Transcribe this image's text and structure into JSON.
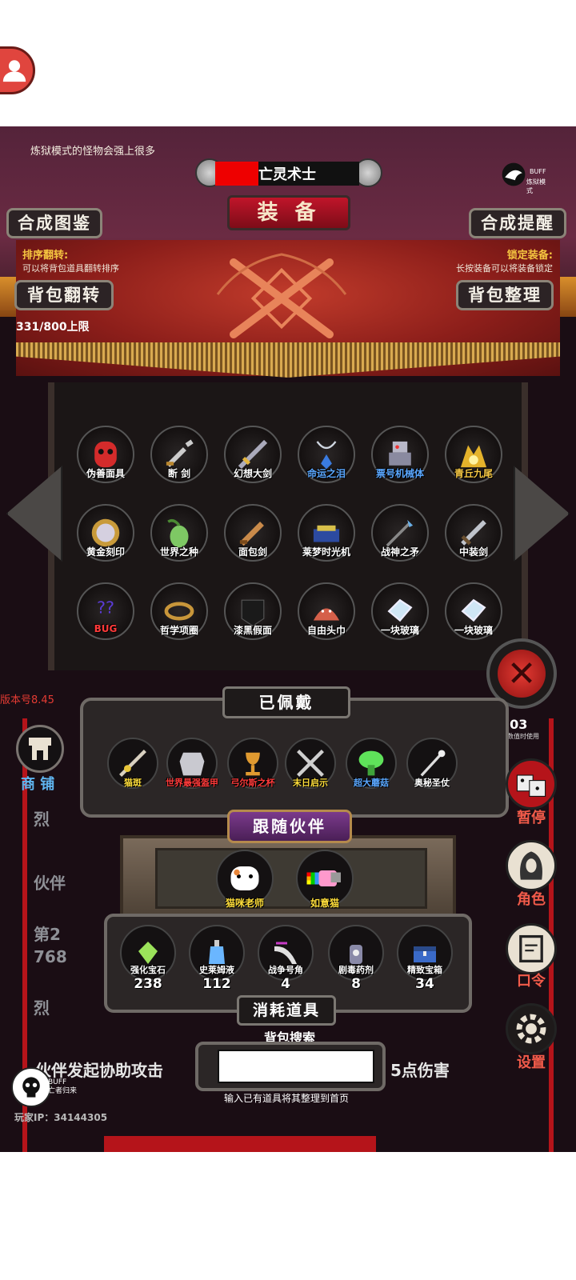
{
  "header": {
    "warning": "炼狱模式的怪物会强上很多",
    "buff_mode_label": "BUFF",
    "buff_mode_text": "炼狱模式",
    "class_name": "亡灵术士",
    "screen_title": "装 备"
  },
  "buttons": {
    "synth_atlas": "合成图鉴",
    "synth_reminder": "合成提醒",
    "bag_flip": "背包翻转",
    "bag_sort": "背包整理"
  },
  "hints": {
    "sort_flip_title": "排序翻转:",
    "sort_flip_desc": "可以将背包道具翻转排序",
    "lock_equip_title": "锁定装备:",
    "lock_equip_desc": "长按装备可以将装备锁定"
  },
  "bag_capacity": "331/800上限",
  "bag_items": [
    {
      "label": "伪善面具",
      "icon": "mask-icon",
      "color": "#ffffff"
    },
    {
      "label": "断 剑",
      "icon": "broken-sword-icon",
      "color": "#ffffff"
    },
    {
      "label": "幻想大剑",
      "icon": "greatsword-icon",
      "color": "#ffffff"
    },
    {
      "label": "命运之泪",
      "icon": "amulet-icon",
      "color": "#5aa7ff"
    },
    {
      "label": "票号机械体",
      "icon": "robot-icon",
      "color": "#5aa7ff"
    },
    {
      "label": "青丘九尾",
      "icon": "fox-icon",
      "color": "#f5c744"
    },
    {
      "label": "黄金刻印",
      "icon": "seal-icon",
      "color": "#ffffff"
    },
    {
      "label": "世界之种",
      "icon": "seed-icon",
      "color": "#ffffff"
    },
    {
      "label": "面包剑",
      "icon": "bread-sword-icon",
      "color": "#ffffff"
    },
    {
      "label": "莱梦时光机",
      "icon": "time-machine-icon",
      "color": "#ffffff"
    },
    {
      "label": "战神之矛",
      "icon": "spear-icon",
      "color": "#ffffff"
    },
    {
      "label": "中装剑",
      "icon": "sword-icon",
      "color": "#ffffff"
    },
    {
      "label": "BUG",
      "icon": "bug-icon",
      "color": "#ff3a3a"
    },
    {
      "label": "哲学项圈",
      "icon": "collar-icon",
      "color": "#ffffff"
    },
    {
      "label": "漆黑假面",
      "icon": "black-mask-icon",
      "color": "#ffffff"
    },
    {
      "label": "自由头巾",
      "icon": "headscarf-icon",
      "color": "#ffffff"
    },
    {
      "label": "一块玻璃",
      "icon": "glass-icon",
      "color": "#ffffff"
    },
    {
      "label": "一块玻璃",
      "icon": "glass-icon",
      "color": "#ffffff"
    }
  ],
  "version": "版本号8.45",
  "shop_label": "商 铺",
  "count_badge": "703",
  "count_badge_note": "其数值时使用",
  "equipped": {
    "title": "已佩戴",
    "items": [
      {
        "label": "猫斑",
        "color": "#ffde3b",
        "icon": "cat-spear-icon"
      },
      {
        "label": "世界最强盔甲",
        "color": "#ff3a3a",
        "icon": "armor-icon"
      },
      {
        "label": "弓尔斯之杯",
        "color": "#ff3a3a",
        "icon": "chalice-icon"
      },
      {
        "label": "末日启示",
        "color": "#ffde3b",
        "icon": "doom-icon"
      },
      {
        "label": "超大蘑菇",
        "color": "#5aa7ff",
        "icon": "mushroom-icon"
      },
      {
        "label": "奥秘圣仗",
        "color": "#ffffff",
        "icon": "staff-icon"
      }
    ]
  },
  "companions": {
    "title": "跟随伙伴",
    "items": [
      {
        "label": "猫咪老师",
        "icon": "cat-teacher-icon"
      },
      {
        "label": "如意猫",
        "icon": "nyan-cat-icon"
      }
    ]
  },
  "consumables": {
    "title": "消耗道具",
    "items": [
      {
        "label": "强化宝石",
        "count": "238",
        "icon": "gem-icon"
      },
      {
        "label": "史莱姆液",
        "count": "112",
        "icon": "potion-icon"
      },
      {
        "label": "战争号角",
        "count": "4",
        "icon": "horn-icon"
      },
      {
        "label": "剧毒药剂",
        "count": "8",
        "icon": "poison-icon"
      },
      {
        "label": "精致宝箱",
        "count": "34",
        "icon": "chest-icon"
      }
    ]
  },
  "search": {
    "title": "背包搜索",
    "value": "",
    "hint": "输入已有道具将其整理到首页"
  },
  "side_menu": {
    "pause": "暂停",
    "role": "角色",
    "code": "口令",
    "settings": "设置"
  },
  "background_texts": {
    "t1": "烈",
    "t2": "伙伴",
    "t3": "第2",
    "t4": "768",
    "t5": "烈",
    "t6": "伙伴发起协助攻击",
    "t7": "5点伤害"
  },
  "bottom_buff": {
    "label": "BUFF",
    "text": "亡者归来"
  },
  "player_ip": "玩家IP：34144305"
}
